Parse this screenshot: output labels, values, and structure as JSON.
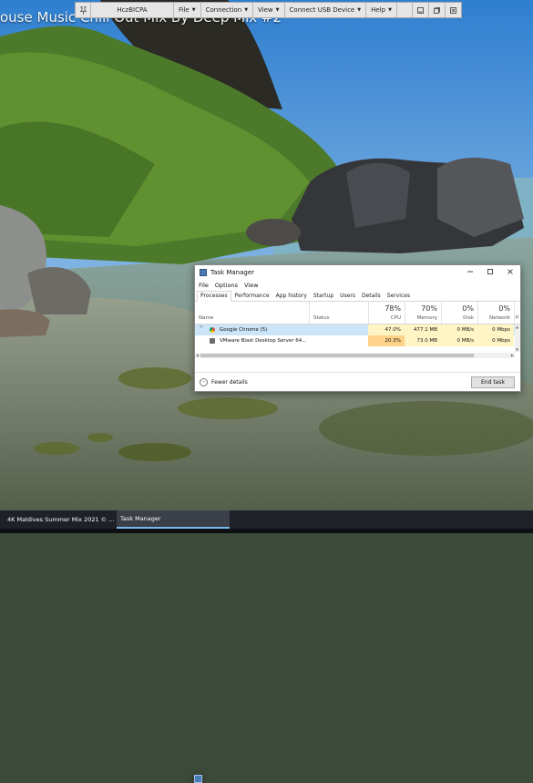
{
  "video": {
    "title": "ouse Music Chill Out Mix By Deep Mix #2"
  },
  "remote_toolbar": {
    "pin_icon": "pin-icon",
    "host": "HczBICPA",
    "menus": [
      {
        "label": "File"
      },
      {
        "label": "Connection"
      },
      {
        "label": "View"
      },
      {
        "label": "Connect USB Device"
      },
      {
        "label": "Help"
      }
    ],
    "controls": [
      "minimize-icon",
      "restore-icon",
      "close-icon"
    ]
  },
  "task_manager": {
    "title": "Task Manager",
    "menu": [
      "File",
      "Options",
      "View"
    ],
    "tabs": [
      "Processes",
      "Performance",
      "App history",
      "Startup",
      "Users",
      "Details",
      "Services"
    ],
    "active_tab": "Processes",
    "columns": {
      "name": "Name",
      "status": "Status",
      "cpu": {
        "percent": "78%",
        "label": "CPU"
      },
      "memory": {
        "percent": "70%",
        "label": "Memory"
      },
      "disk": {
        "percent": "0%",
        "label": "Disk"
      },
      "network": {
        "percent": "0%",
        "label": "Network"
      },
      "extra": {
        "label": "P"
      }
    },
    "rows": [
      {
        "name": "Google Chrome (5)",
        "status": "",
        "cpu": "47.0%",
        "memory": "477.1 MB",
        "disk": "0 MB/s",
        "network": "0 Mbps",
        "icon": "chrome-icon",
        "selected": true,
        "expander": ">"
      },
      {
        "name": "VMware Blast Desktop Server 64...",
        "status": "",
        "cpu": "20.3%",
        "memory": "73.0 MB",
        "disk": "0 MB/s",
        "network": "0 Mbps",
        "icon": "vmware-icon",
        "selected": false,
        "expander": ""
      }
    ],
    "footer": {
      "fewer_details": "Fewer details",
      "end_task": "End task"
    }
  },
  "taskbar": {
    "items": [
      {
        "label": "4K Maldives Summer Mix 2021 © ...",
        "icon": "chrome-icon",
        "active": false
      },
      {
        "label": "Task Manager",
        "icon": "task-manager-icon",
        "active": true
      }
    ]
  }
}
